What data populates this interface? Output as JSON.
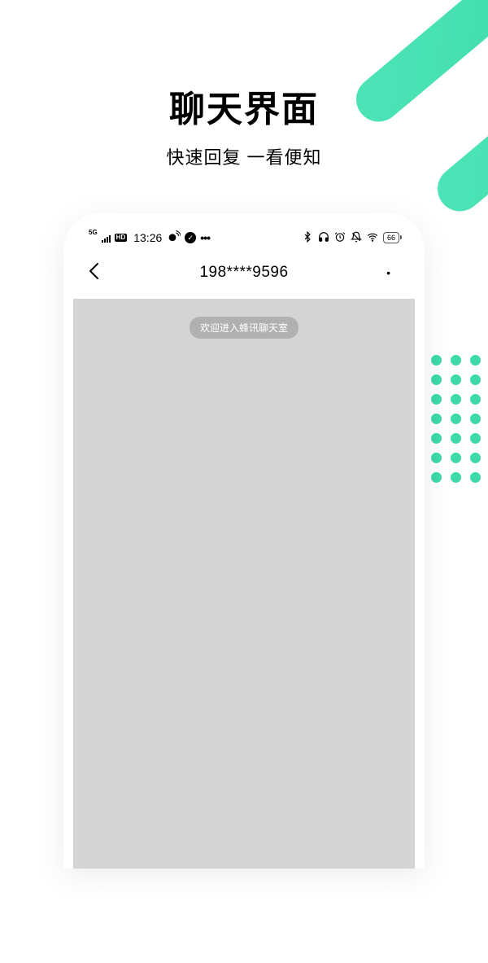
{
  "promo": {
    "title": "聊天界面",
    "subtitle": "快速回复 一看便知"
  },
  "statusBar": {
    "networkLabel": "5G",
    "hdLabel": "HD",
    "time": "13:26",
    "dots": "•••",
    "battery": "66"
  },
  "nav": {
    "title": "198****9596",
    "moreLabel": "•"
  },
  "chat": {
    "welcome": "欢迎进入蜂讯聊天室"
  }
}
